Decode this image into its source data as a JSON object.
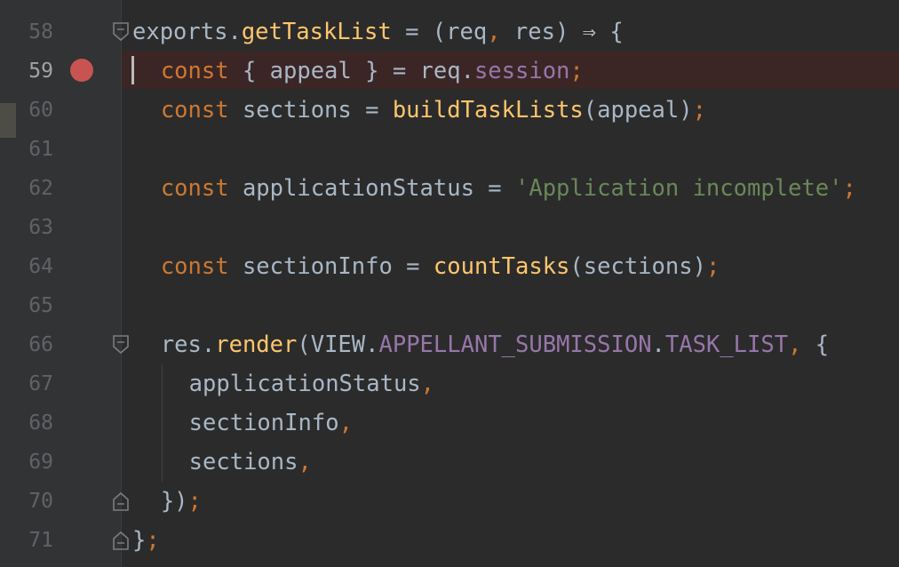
{
  "editor": {
    "language": "javascript",
    "current_line": "59",
    "breakpoint_line": "59",
    "colors": {
      "background": "#2b2b2b",
      "gutter": "#313335",
      "keyword": "#cc7832",
      "function": "#ffc66d",
      "property": "#9876aa",
      "string": "#6a8759",
      "identifier": "#a9b7c6",
      "breakpoint": "#c75450",
      "breakpoint_line_bg": "#3b2625"
    },
    "line_numbers": [
      "58",
      "59",
      "60",
      "61",
      "62",
      "63",
      "64",
      "65",
      "66",
      "67",
      "68",
      "69",
      "70",
      "71"
    ],
    "lines": [
      {
        "tokens": [
          {
            "t": "exports",
            "c": "id"
          },
          {
            "t": ".",
            "c": "id"
          },
          {
            "t": "getTaskList",
            "c": "fn"
          },
          {
            "t": " = (",
            "c": "id"
          },
          {
            "t": "req",
            "c": "id"
          },
          {
            "t": ",",
            "c": "punc"
          },
          {
            "t": " res) ⇒ {",
            "c": "id"
          }
        ]
      },
      {
        "tokens": [
          {
            "t": "const",
            "c": "kw"
          },
          {
            "t": " { appeal } = req.",
            "c": "id"
          },
          {
            "t": "session",
            "c": "prop"
          },
          {
            "t": ";",
            "c": "punc"
          }
        ]
      },
      {
        "tokens": [
          {
            "t": "const",
            "c": "kw"
          },
          {
            "t": " sections = ",
            "c": "id"
          },
          {
            "t": "buildTaskLists",
            "c": "fn"
          },
          {
            "t": "(appeal)",
            "c": "id"
          },
          {
            "t": ";",
            "c": "punc"
          }
        ]
      },
      {
        "tokens": []
      },
      {
        "tokens": [
          {
            "t": "const",
            "c": "kw"
          },
          {
            "t": " applicationStatus = ",
            "c": "id"
          },
          {
            "t": "'Application incomplete'",
            "c": "str"
          },
          {
            "t": ";",
            "c": "punc"
          }
        ]
      },
      {
        "tokens": []
      },
      {
        "tokens": [
          {
            "t": "const",
            "c": "kw"
          },
          {
            "t": " sectionInfo = ",
            "c": "id"
          },
          {
            "t": "countTasks",
            "c": "fn"
          },
          {
            "t": "(sections)",
            "c": "id"
          },
          {
            "t": ";",
            "c": "punc"
          }
        ]
      },
      {
        "tokens": []
      },
      {
        "tokens": [
          {
            "t": "res.",
            "c": "id"
          },
          {
            "t": "render",
            "c": "fn"
          },
          {
            "t": "(VIEW.",
            "c": "id"
          },
          {
            "t": "APPELLANT_SUBMISSION",
            "c": "prop"
          },
          {
            "t": ".",
            "c": "id"
          },
          {
            "t": "TASK_LIST",
            "c": "prop"
          },
          {
            "t": ",",
            "c": "punc"
          },
          {
            "t": " {",
            "c": "id"
          }
        ]
      },
      {
        "tokens": [
          {
            "t": "applicationStatus",
            "c": "id"
          },
          {
            "t": ",",
            "c": "punc"
          }
        ]
      },
      {
        "tokens": [
          {
            "t": "sectionInfo",
            "c": "id"
          },
          {
            "t": ",",
            "c": "punc"
          }
        ]
      },
      {
        "tokens": [
          {
            "t": "sections",
            "c": "id"
          },
          {
            "t": ",",
            "c": "punc"
          }
        ]
      },
      {
        "tokens": [
          {
            "t": "})",
            "c": "id"
          },
          {
            "t": ";",
            "c": "punc"
          }
        ]
      },
      {
        "tokens": [
          {
            "t": "}",
            "c": "id"
          },
          {
            "t": ";",
            "c": "punc"
          }
        ]
      }
    ]
  }
}
